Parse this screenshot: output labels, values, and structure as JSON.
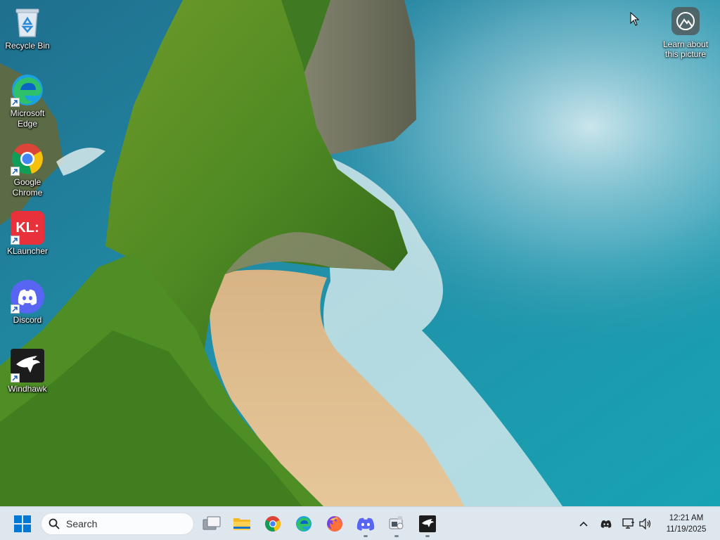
{
  "desktop": {
    "icons": [
      {
        "label": "Recycle Bin",
        "icon": "recycle-bin-icon"
      },
      {
        "label": "Microsoft Edge",
        "icon": "edge-icon"
      },
      {
        "label": "Google Chrome",
        "icon": "chrome-icon"
      },
      {
        "label": "KLauncher",
        "icon": "klauncher-icon",
        "tile_text": "KL:"
      },
      {
        "label": "Discord",
        "icon": "discord-icon"
      },
      {
        "label": "Windhawk",
        "icon": "windhawk-icon"
      }
    ],
    "learn_picture": {
      "label": "Learn about this picture",
      "icon": "learn-picture-icon"
    }
  },
  "taskbar": {
    "search_placeholder": "Search",
    "pinned": [
      {
        "name": "task-view",
        "icon": "task-view-icon"
      },
      {
        "name": "file-explorer",
        "icon": "folder-icon"
      },
      {
        "name": "chrome",
        "icon": "chrome-icon"
      },
      {
        "name": "edge",
        "icon": "edge-icon"
      },
      {
        "name": "firefox",
        "icon": "firefox-icon"
      },
      {
        "name": "discord",
        "icon": "discord-icon",
        "running": true
      },
      {
        "name": "app-window",
        "icon": "app-icon",
        "running": true
      },
      {
        "name": "windhawk",
        "icon": "windhawk-icon",
        "running": true
      }
    ],
    "tray": {
      "icons": [
        "chevron-up-icon",
        "discord-tray-icon",
        "network-icon",
        "volume-icon"
      ],
      "time": "12:21 AM",
      "date": "11/19/2025"
    }
  },
  "colors": {
    "taskbar_bg": "#dfe7ee",
    "windows_blue": "#0078d4",
    "discord": "#5865f2",
    "klauncher": "#e8313a"
  }
}
